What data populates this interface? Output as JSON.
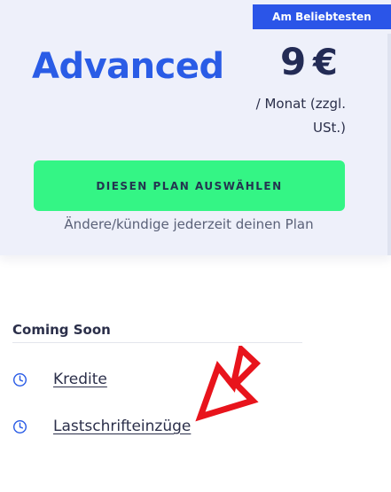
{
  "badge": {
    "label": "Am Beliebtesten"
  },
  "plan": {
    "name": "Advanced",
    "price_amount": "9",
    "price_currency": "€",
    "price_note": "/ Monat (zzgl. USt.)",
    "select_button_label": "DIESEN PLAN AUSWÄHLEN",
    "change_note": "Ändere/kündige jederzeit deinen Plan"
  },
  "coming_soon": {
    "heading": "Coming Soon",
    "items": [
      {
        "label": "Kredite",
        "icon": "clock-icon"
      },
      {
        "label": "Lastschrifteinzüge",
        "icon": "clock-icon"
      }
    ]
  },
  "annotation": {
    "icon": "arrow-down-left-icon",
    "color": "#e8141c"
  },
  "colors": {
    "accent": "#2a5ce6",
    "badge": "#2b55e8",
    "button": "#34f585",
    "card_background": "#eef0fa",
    "text_dark": "#232b55"
  }
}
